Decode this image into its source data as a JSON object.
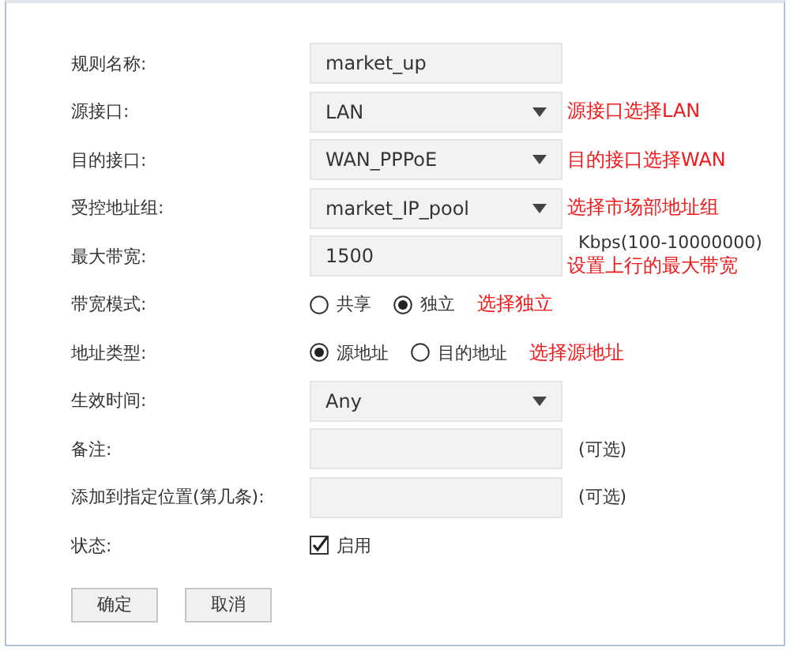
{
  "rows": [
    {
      "kind": "input",
      "label": "规则名称:",
      "value": "market_up"
    },
    {
      "kind": "select",
      "label": "源接口:",
      "value": "LAN",
      "note": "源接口选择LAN"
    },
    {
      "kind": "select",
      "label": "目的接口:",
      "value": "WAN_PPPoE",
      "note": "目的接口选择WAN"
    },
    {
      "kind": "select",
      "label": "受控地址组:",
      "value": "market_IP_pool",
      "note": "选择市场部地址组"
    },
    {
      "kind": "input",
      "label": "最大带宽:",
      "value": "1500",
      "suffix": "Kbps(100-10000000)",
      "note": "设置上行的最大带宽"
    },
    {
      "kind": "radio",
      "label": "带宽模式:",
      "options": [
        {
          "label": "共享",
          "selected": false
        },
        {
          "label": "独立",
          "selected": true
        }
      ],
      "note": "选择独立"
    },
    {
      "kind": "radio",
      "label": "地址类型:",
      "options": [
        {
          "label": "源地址",
          "selected": true
        },
        {
          "label": "目的地址",
          "selected": false
        }
      ],
      "note": "选择源地址"
    },
    {
      "kind": "select",
      "label": "生效时间:",
      "value": "Any"
    },
    {
      "kind": "input",
      "label": "备注:",
      "suffix": "(可选)"
    },
    {
      "kind": "input",
      "label": "添加到指定位置(第几条):",
      "suffix": "(可选)"
    },
    {
      "kind": "checkbox",
      "label": "状态:",
      "text": "启用",
      "checked": true
    }
  ],
  "buttons": [
    "确定",
    "取消"
  ]
}
